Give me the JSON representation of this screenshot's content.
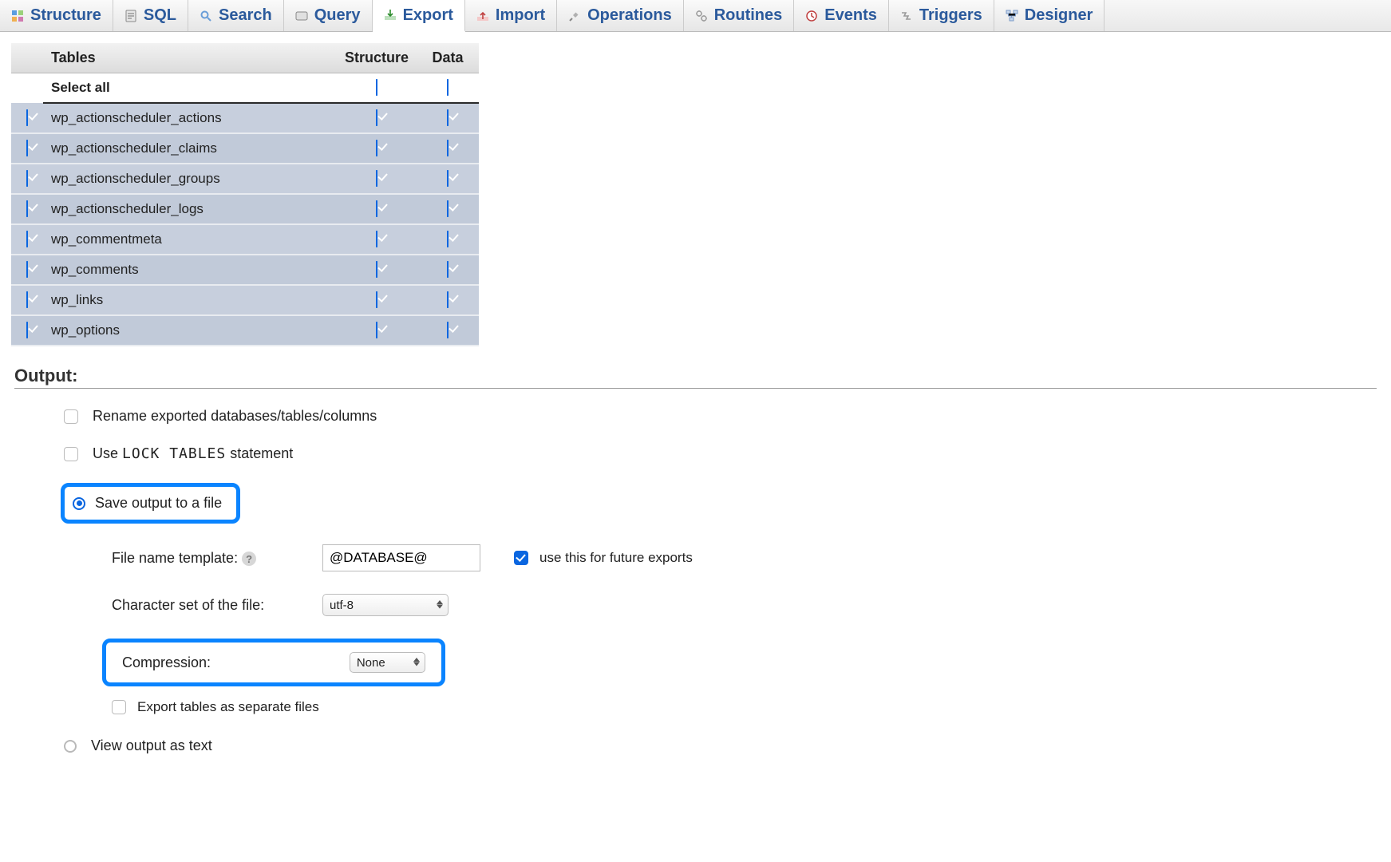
{
  "tabs": [
    {
      "label": "Structure",
      "icon": "structure"
    },
    {
      "label": "SQL",
      "icon": "sql"
    },
    {
      "label": "Search",
      "icon": "search"
    },
    {
      "label": "Query",
      "icon": "query"
    },
    {
      "label": "Export",
      "icon": "export",
      "active": true
    },
    {
      "label": "Import",
      "icon": "import"
    },
    {
      "label": "Operations",
      "icon": "operations"
    },
    {
      "label": "Routines",
      "icon": "routines"
    },
    {
      "label": "Events",
      "icon": "events"
    },
    {
      "label": "Triggers",
      "icon": "triggers"
    },
    {
      "label": "Designer",
      "icon": "designer"
    }
  ],
  "table_header": {
    "tables": "Tables",
    "structure": "Structure",
    "data": "Data",
    "select_all": "Select all"
  },
  "tables": [
    {
      "name": "wp_actionscheduler_actions",
      "structure": true,
      "data": true
    },
    {
      "name": "wp_actionscheduler_claims",
      "structure": true,
      "data": true
    },
    {
      "name": "wp_actionscheduler_groups",
      "structure": true,
      "data": true
    },
    {
      "name": "wp_actionscheduler_logs",
      "structure": true,
      "data": true
    },
    {
      "name": "wp_commentmeta",
      "structure": true,
      "data": true
    },
    {
      "name": "wp_comments",
      "structure": true,
      "data": true
    },
    {
      "name": "wp_links",
      "structure": true,
      "data": true
    },
    {
      "name": "wp_options",
      "structure": true,
      "data": true
    }
  ],
  "output": {
    "heading": "Output:",
    "rename_label": "Rename exported databases/tables/columns",
    "lock_pre": "Use ",
    "lock_mono": "LOCK TABLES",
    "lock_post": " statement",
    "save_to_file_label": "Save output to a file",
    "filename_label": "File name template:",
    "filename_value": "@DATABASE@",
    "future_exports_label": "use this for future exports",
    "charset_label": "Character set of the file:",
    "charset_value": "utf-8",
    "compression_label": "Compression:",
    "compression_value": "None",
    "export_separate_label": "Export tables as separate files",
    "view_as_text_label": "View output as text"
  }
}
